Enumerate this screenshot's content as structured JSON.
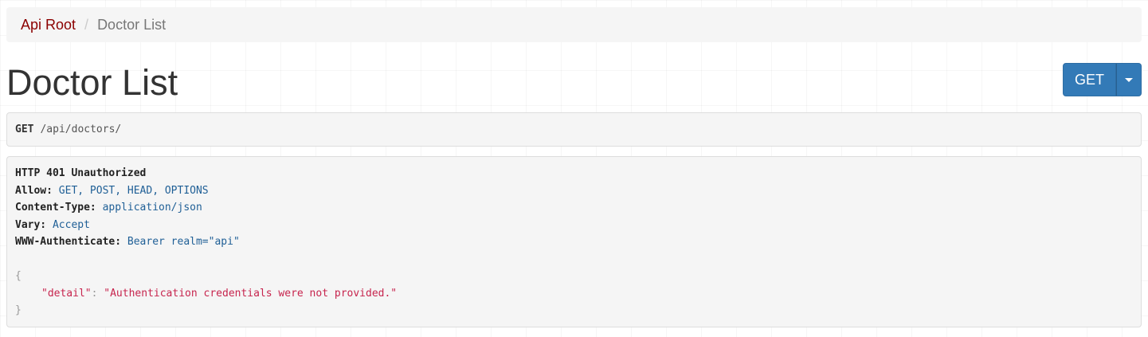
{
  "breadcrumb": {
    "root_label": "Api Root",
    "separator": "/",
    "current_label": "Doctor List"
  },
  "page": {
    "title": "Doctor List"
  },
  "method_buttons": {
    "get_label": "GET",
    "dropdown_icon": "caret-down-icon"
  },
  "request": {
    "method": "GET",
    "path": "/api/doctors/"
  },
  "response": {
    "status_line": "HTTP 401 Unauthorized",
    "headers": [
      {
        "name": "Allow:",
        "value": "GET, POST, HEAD, OPTIONS"
      },
      {
        "name": "Content-Type:",
        "value": "application/json"
      },
      {
        "name": "Vary:",
        "value": "Accept"
      },
      {
        "name": "WWW-Authenticate:",
        "value": "Bearer realm=\"api\""
      }
    ],
    "body": {
      "open_brace": "{",
      "key": "\"detail\"",
      "colon": ":",
      "value": "\"Authentication credentials were not provided.\"",
      "close_brace": "}"
    }
  },
  "colors": {
    "link": "#8b0000",
    "primary_button": "#337ab7",
    "header_value": "#1f5f96",
    "json_string": "#c7254e"
  }
}
